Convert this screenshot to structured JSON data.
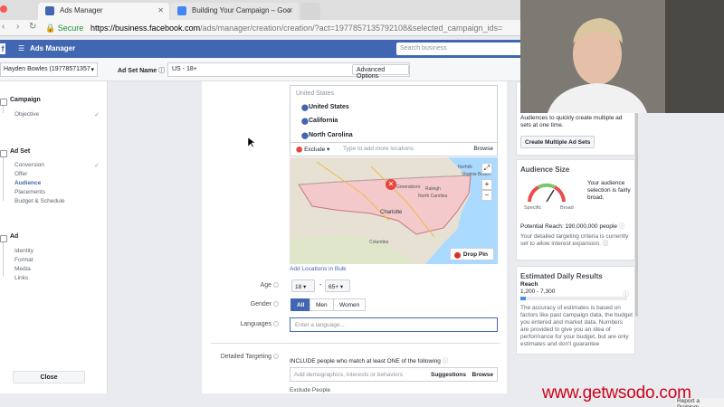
{
  "browser": {
    "tabs": [
      {
        "title": "Ads Manager"
      },
      {
        "title": "Building Your Campaign – Goo"
      }
    ],
    "secure_label": "Secure",
    "url_domain": "https://business.facebook.com",
    "url_rest": "/ads/manager/creation/creation/?act=1977857135792108&selected_campaign_ids="
  },
  "fb_header": {
    "title": "Ads Manager",
    "search_placeholder": "Search business"
  },
  "account_bar": {
    "account": "Hayden Bowles (19778571357",
    "adset_name_label": "Ad Set Name",
    "adset_name_value": "US - 18+",
    "advanced_options": "Advanced Options"
  },
  "sidebar": {
    "campaign": {
      "label": "Campaign",
      "items": [
        "Objective"
      ]
    },
    "adset": {
      "label": "Ad Set",
      "items": [
        "Conversion",
        "Offer",
        "Audience",
        "Placements",
        "Budget & Schedule"
      ]
    },
    "ad": {
      "label": "Ad",
      "items": [
        "Identity",
        "Format",
        "Media",
        "Links"
      ]
    },
    "close": "Close"
  },
  "locations": {
    "header": "United States",
    "items": [
      "United States",
      "California",
      "North Carolina"
    ],
    "exclude": "Exclude",
    "add_placeholder": "Type to add more locations",
    "browse": "Browse",
    "map_labels": {
      "city": "Charlotte",
      "north_carolina": "North Carolina",
      "columbia": "Columbia",
      "raleigh": "Raleigh",
      "greensboro": "Greensboro",
      "norfolk": "Norfolk",
      "virginia_beach": "Virginia Beach"
    },
    "drop_pin": "Drop Pin",
    "add_bulk": "Add Locations in Bulk"
  },
  "form": {
    "age_label": "Age",
    "age_min": "18",
    "age_max": "65+",
    "gender_label": "Gender",
    "gender_options": [
      "All",
      "Men",
      "Women"
    ],
    "languages_label": "Languages",
    "languages_placeholder": "Enter a language...",
    "detailed_label": "Detailed Targeting",
    "detailed_text": "INCLUDE people who match at least ONE of the following",
    "detailed_placeholder": "Add demographics, interests or behaviors",
    "suggestions": "Suggestions",
    "browse": "Browse",
    "exclude_people": "Exclude People"
  },
  "right": {
    "audiences_text": "Audiences to quickly create multiple ad sets at one time.",
    "create_button": "Create Multiple Ad Sets",
    "audience_size_title": "Audience Size",
    "audience_desc": "Your audience selection is fairly broad.",
    "specific": "Specific",
    "broad": "Broad",
    "potential_reach": "Potential Reach: 190,000,000 people",
    "criteria_text": "Your detailed targeting criteria is currently set to allow interest expansion.",
    "estimated_title": "Estimated Daily Results",
    "reach_label": "Reach",
    "reach_value": "1,200 - 7,300",
    "accuracy_text": "The accuracy of estimates is based on factors like past campaign data, the budget you entered and market data. Numbers are provided to give you an idea of performance for your budget, but are only estimates and don't guarantee"
  },
  "watermark": "www.getwsodo.com",
  "report_problem": "Report a Problem",
  "colors": {
    "fb_blue": "#4267b2",
    "watermark_red": "#d0021b",
    "pin_red": "#e8453c"
  }
}
